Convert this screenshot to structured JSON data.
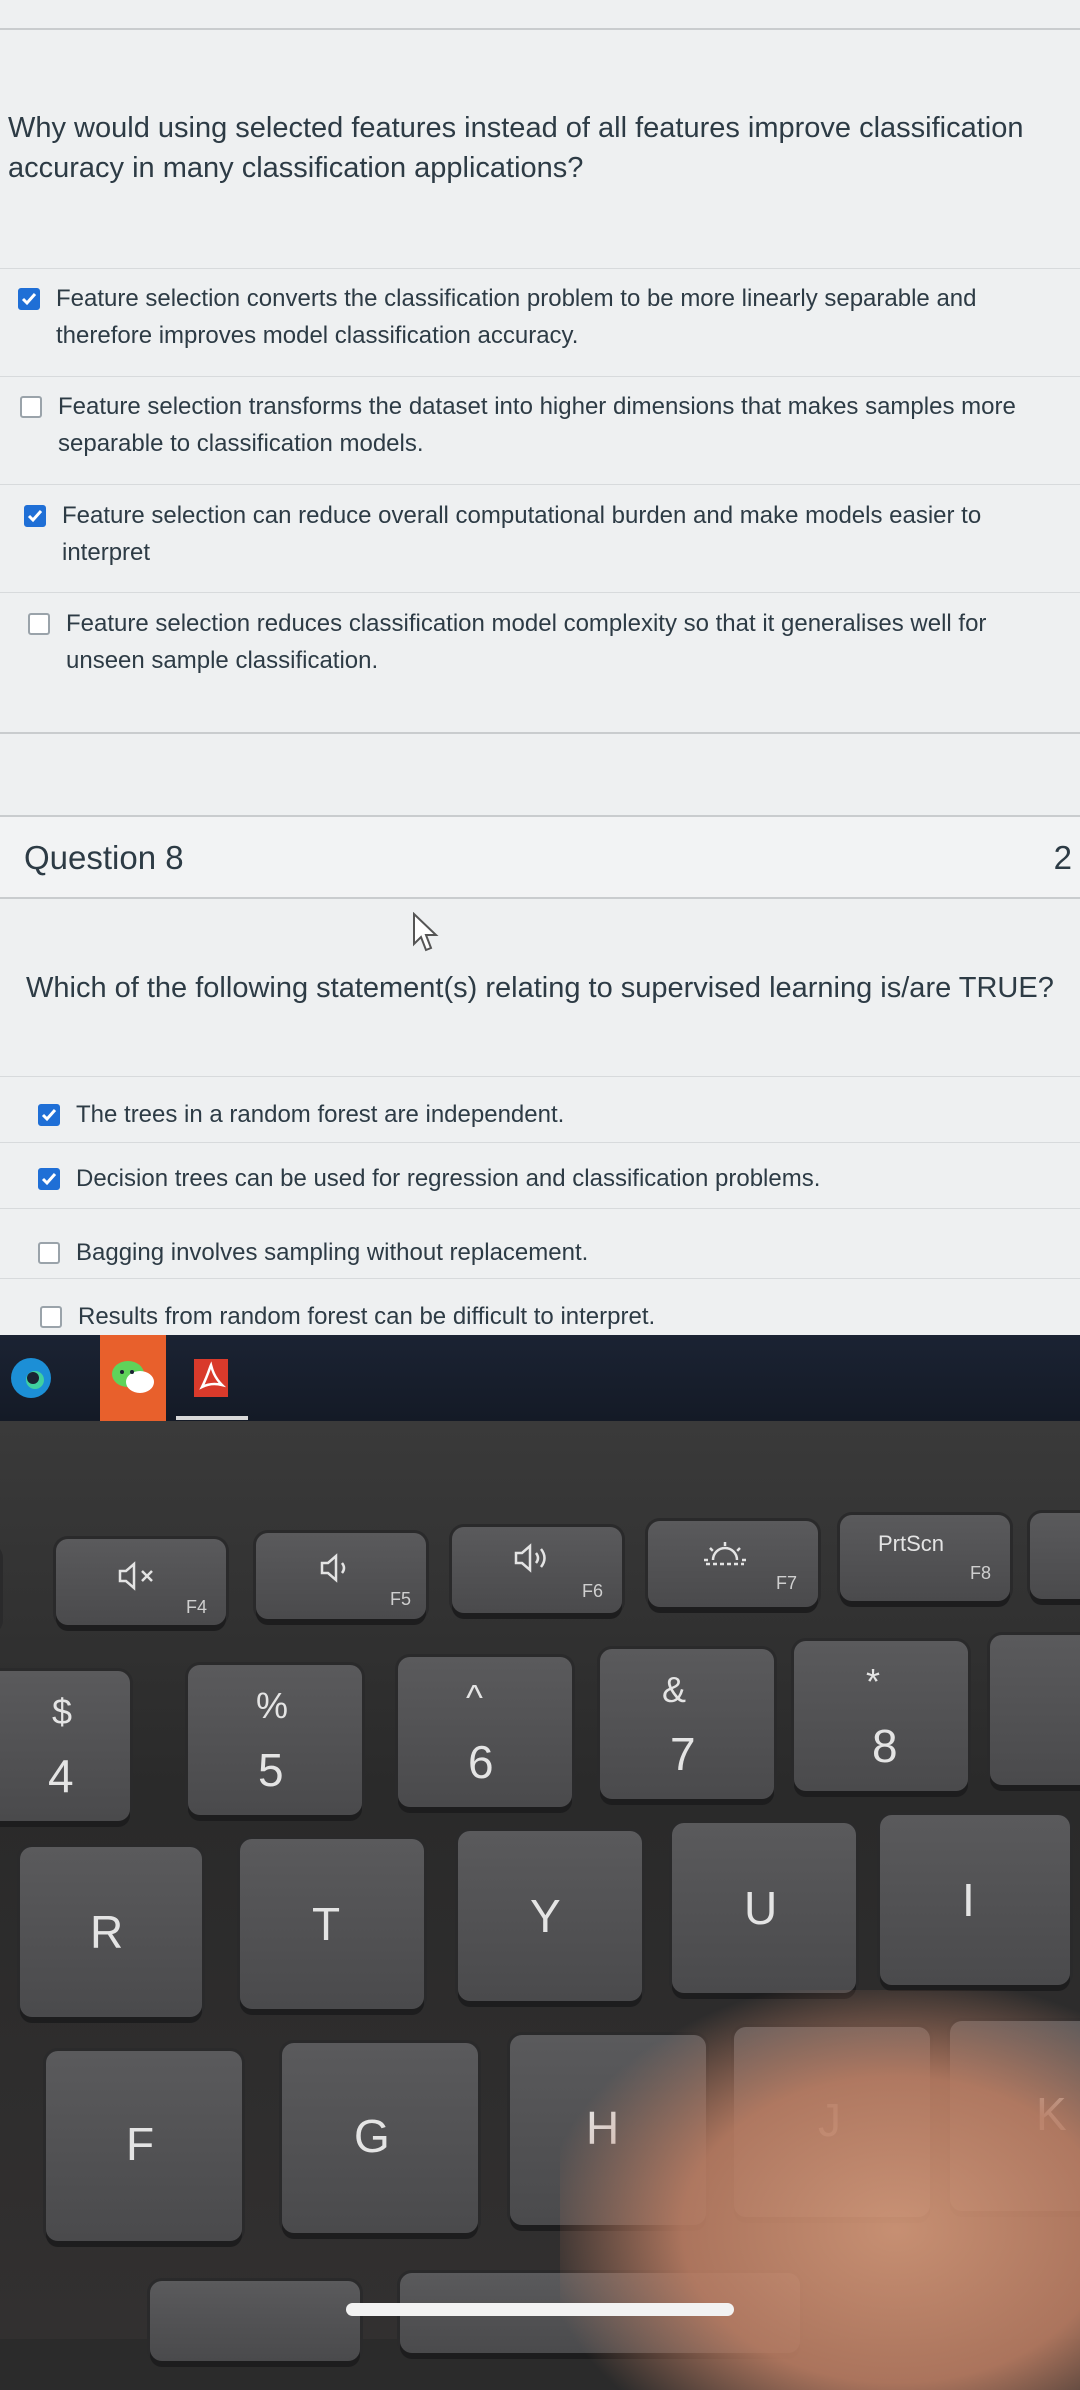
{
  "question7": {
    "text": "Why would using selected features instead of all features improve classification accuracy in many classification applications?",
    "options": [
      {
        "label": "Feature selection converts the classification problem to be more linearly separable and therefore improves model classification accuracy.",
        "checked": true
      },
      {
        "label": "Feature selection transforms the dataset into higher dimensions that makes samples more separable to classification models.",
        "checked": false
      },
      {
        "label": "Feature selection can reduce overall computational burden and make models easier to interpret",
        "checked": true
      },
      {
        "label": "Feature selection reduces classification model complexity so that it generalises well for unseen sample classification.",
        "checked": false
      }
    ]
  },
  "question8": {
    "title": "Question 8",
    "points": "2",
    "text": "Which of the following statement(s) relating to supervised learning is/are TRUE?",
    "options": [
      {
        "label": "The trees in a random forest are independent.",
        "checked": true
      },
      {
        "label": "Decision trees can be used for regression and classification problems.",
        "checked": true
      },
      {
        "label": "Bagging involves sampling without replacement.",
        "checked": false
      },
      {
        "label": "Results from random forest can be difficult to interpret.",
        "checked": false
      }
    ]
  },
  "taskbar": {
    "apps": [
      "edge-icon",
      "wechat-icon",
      "acrobat-icon"
    ]
  },
  "keyboard": {
    "fn_row": [
      {
        "label": "F4",
        "icon": "mute-icon"
      },
      {
        "label": "F5",
        "icon": "volume-down-icon"
      },
      {
        "label": "F6",
        "icon": "volume-up-icon"
      },
      {
        "label": "F7",
        "icon": "brightness-icon"
      },
      {
        "label": "F8",
        "text": "PrtScn"
      }
    ],
    "number_row": [
      {
        "top": "$",
        "bottom": "4"
      },
      {
        "top": "%",
        "bottom": "5"
      },
      {
        "top": "^",
        "bottom": "6"
      },
      {
        "top": "&",
        "bottom": "7"
      },
      {
        "top": "*",
        "bottom": "8"
      }
    ],
    "letter_row1": [
      "R",
      "T",
      "Y",
      "U",
      "I"
    ],
    "letter_row2": [
      "F",
      "G",
      "H",
      "J",
      "K"
    ]
  }
}
